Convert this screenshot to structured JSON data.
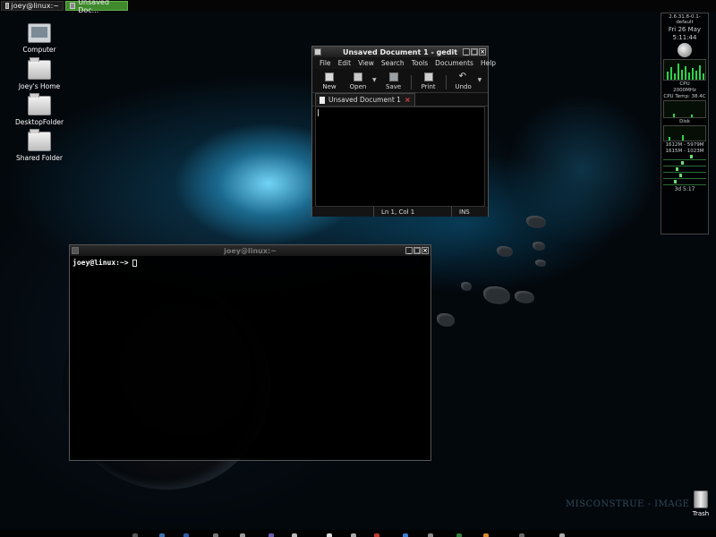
{
  "top_panel": {
    "tasks": [
      {
        "label": "joey@linux:~"
      },
      {
        "label": "Unsaved Doc..."
      }
    ]
  },
  "desktop_icons": [
    {
      "label": "Computer",
      "icon": "computer-icon"
    },
    {
      "label": "Joey's Home",
      "icon": "home-folder-icon"
    },
    {
      "label": "DesktopFolder",
      "icon": "folder-icon"
    },
    {
      "label": "Shared Folder",
      "icon": "folder-icon"
    }
  ],
  "gedit": {
    "title": "Unsaved Document 1 - gedit",
    "menu": [
      "File",
      "Edit",
      "View",
      "Search",
      "Tools",
      "Documents",
      "Help"
    ],
    "toolbar": {
      "new": "New",
      "open": "Open",
      "save": "Save",
      "print": "Print",
      "undo": "Undo"
    },
    "tab_label": "Unsaved Document 1",
    "status_position": "Ln 1, Col 1",
    "status_mode": "INS"
  },
  "terminal": {
    "title": "joey@linux:~",
    "prompt": "joey@linux:~>"
  },
  "widget": {
    "kernel": "2.6.31.8-0.1-default",
    "date": "Fri 26 May",
    "time": "5:11:44",
    "cpu_label": "CPU",
    "freq": "2000MHz",
    "cpu_temp": "CPU Temp: 38.4C",
    "disk_label": "Disk",
    "mem_a": "1612M - 5979M",
    "mem_b": "1615M - 1023M",
    "uptime": "3d 5:17"
  },
  "watermark": "MISCONSTRUE - IMAGE 1",
  "trash_label": "Trash",
  "colors": {
    "active_task": "#3f8a2c",
    "graph": "#2dd34b",
    "close_x": "#e04a3a"
  }
}
